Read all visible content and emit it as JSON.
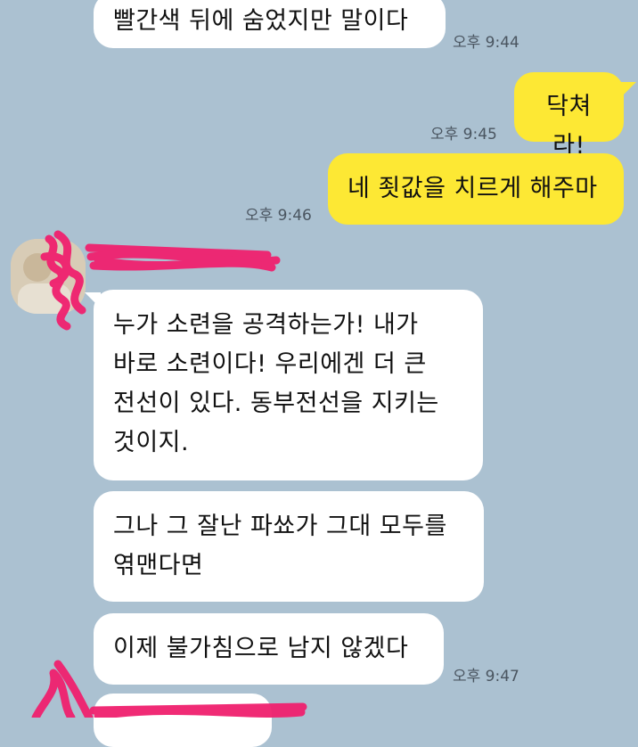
{
  "messages": [
    {
      "id": "m1",
      "side": "in",
      "text": "빨간색 뒤에 숨었지만 말이다",
      "time": ""
    },
    {
      "id": "m2",
      "side": "out",
      "text": "닥쳐라!",
      "time": "오후 9:44"
    },
    {
      "id": "m3",
      "side": "out",
      "text": "네 죗값을 치르게 해주마",
      "time": "오후 9:45"
    },
    {
      "id": "m4",
      "side": "in",
      "text": "누가 소련을 공격하는가! 내가\n바로 소련이다! 우리에겐 더 큰\n전선이 있다. 동부전선을 지키는\n것이지.",
      "time": "오후 9:46"
    },
    {
      "id": "m5",
      "side": "in",
      "text": "그나 그 잘난 파쑈가 그대 모두를\n엮맨다면",
      "time": ""
    },
    {
      "id": "m6",
      "side": "in",
      "text": "이제 불가침으로 남지 않겠다",
      "time": "오후 9:47"
    }
  ],
  "colors": {
    "background": "#abc1d1",
    "incoming_bubble": "#ffffff",
    "outgoing_bubble": "#fde834",
    "redaction": "#f0206e"
  },
  "icons": {
    "sender_avatar": "avatar-icon"
  }
}
